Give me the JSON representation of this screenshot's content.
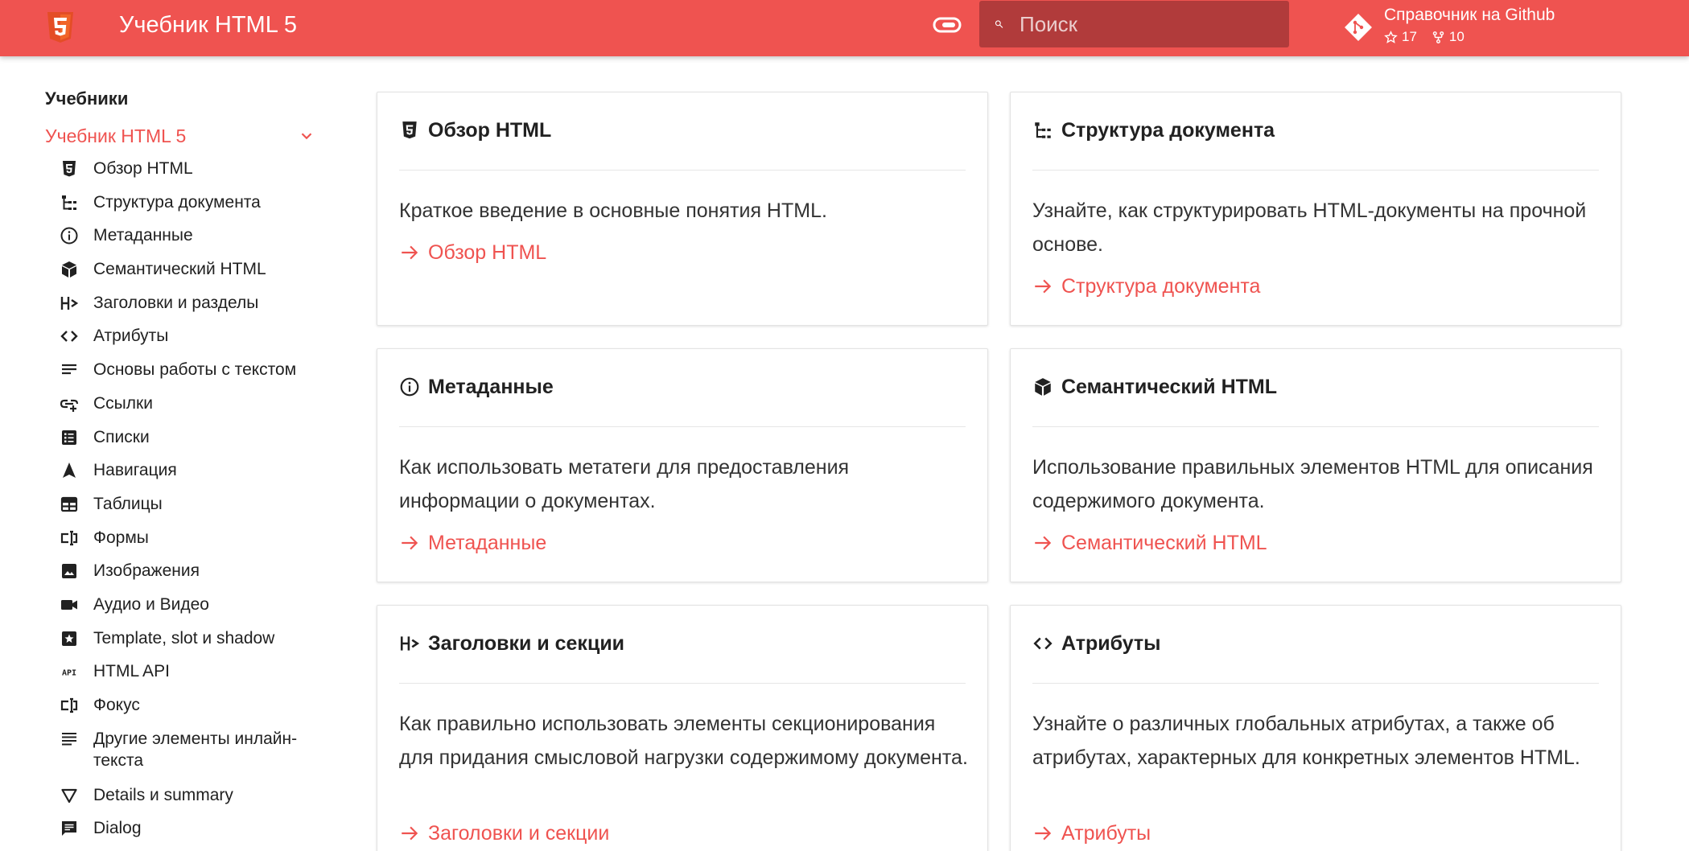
{
  "colors": {
    "accent": "#ef5350",
    "search_bg": "#b13b3b"
  },
  "header": {
    "title": "Учебник HTML 5",
    "search_placeholder": "Поиск",
    "repo_name": "Справочник на Github",
    "stars": "17",
    "forks": "10"
  },
  "sidebar": {
    "heading": "Учебники",
    "active": "Учебник HTML 5",
    "items": [
      {
        "label": "Обзор HTML",
        "icon": "html5-icon"
      },
      {
        "label": "Структура документа",
        "icon": "file-tree-icon"
      },
      {
        "label": "Метаданные",
        "icon": "info-icon"
      },
      {
        "label": "Семантический HTML",
        "icon": "cube-icon"
      },
      {
        "label": "Заголовки и разделы",
        "icon": "heading-icon"
      },
      {
        "label": "Атрибуты",
        "icon": "code-icon"
      },
      {
        "label": "Основы работы с текстом",
        "icon": "text-lines-icon"
      },
      {
        "label": "Ссылки",
        "icon": "link-icon"
      },
      {
        "label": "Списки",
        "icon": "list-icon"
      },
      {
        "label": "Навигация",
        "icon": "navigation-icon"
      },
      {
        "label": "Таблицы",
        "icon": "table-icon"
      },
      {
        "label": "Формы",
        "icon": "form-icon"
      },
      {
        "label": "Изображения",
        "icon": "image-icon"
      },
      {
        "label": "Аудио и Видео",
        "icon": "video-icon"
      },
      {
        "label": "Template, slot и shadow",
        "icon": "star-box-icon"
      },
      {
        "label": "HTML API",
        "icon": "api-icon"
      },
      {
        "label": "Фокус",
        "icon": "focus-icon"
      },
      {
        "label": "Другие элементы инлайн-текста",
        "icon": "text-align-icon"
      },
      {
        "label": "Details и summary",
        "icon": "triangle-down-icon"
      },
      {
        "label": "Dialog",
        "icon": "message-icon"
      }
    ]
  },
  "cards": [
    {
      "title": "Обзор HTML",
      "text": "Краткое введение в основные понятия HTML.",
      "link": "Обзор HTML"
    },
    {
      "title": "Структура документа",
      "text": "Узнайте, как структурировать HTML-документы на прочной основе.",
      "link": "Структура документа"
    },
    {
      "title": "Метаданные",
      "text": "Как использовать метатеги для предоставления информации о документах.",
      "link": "Метаданные"
    },
    {
      "title": "Семантический HTML",
      "text": "Использование правильных элементов HTML для описания содержимого документа.",
      "link": "Семантический HTML"
    },
    {
      "title": "Заголовки и секции",
      "text": "Как правильно использовать элементы секционирования для придания смысловой нагрузки содержимому документа.",
      "link": "Заголовки и секции"
    },
    {
      "title": "Атрибуты",
      "text": "Узнайте о различных глобальных атрибутах, а также об атрибутах, характерных для конкретных элементов HTML.",
      "link": "Атрибуты"
    }
  ]
}
